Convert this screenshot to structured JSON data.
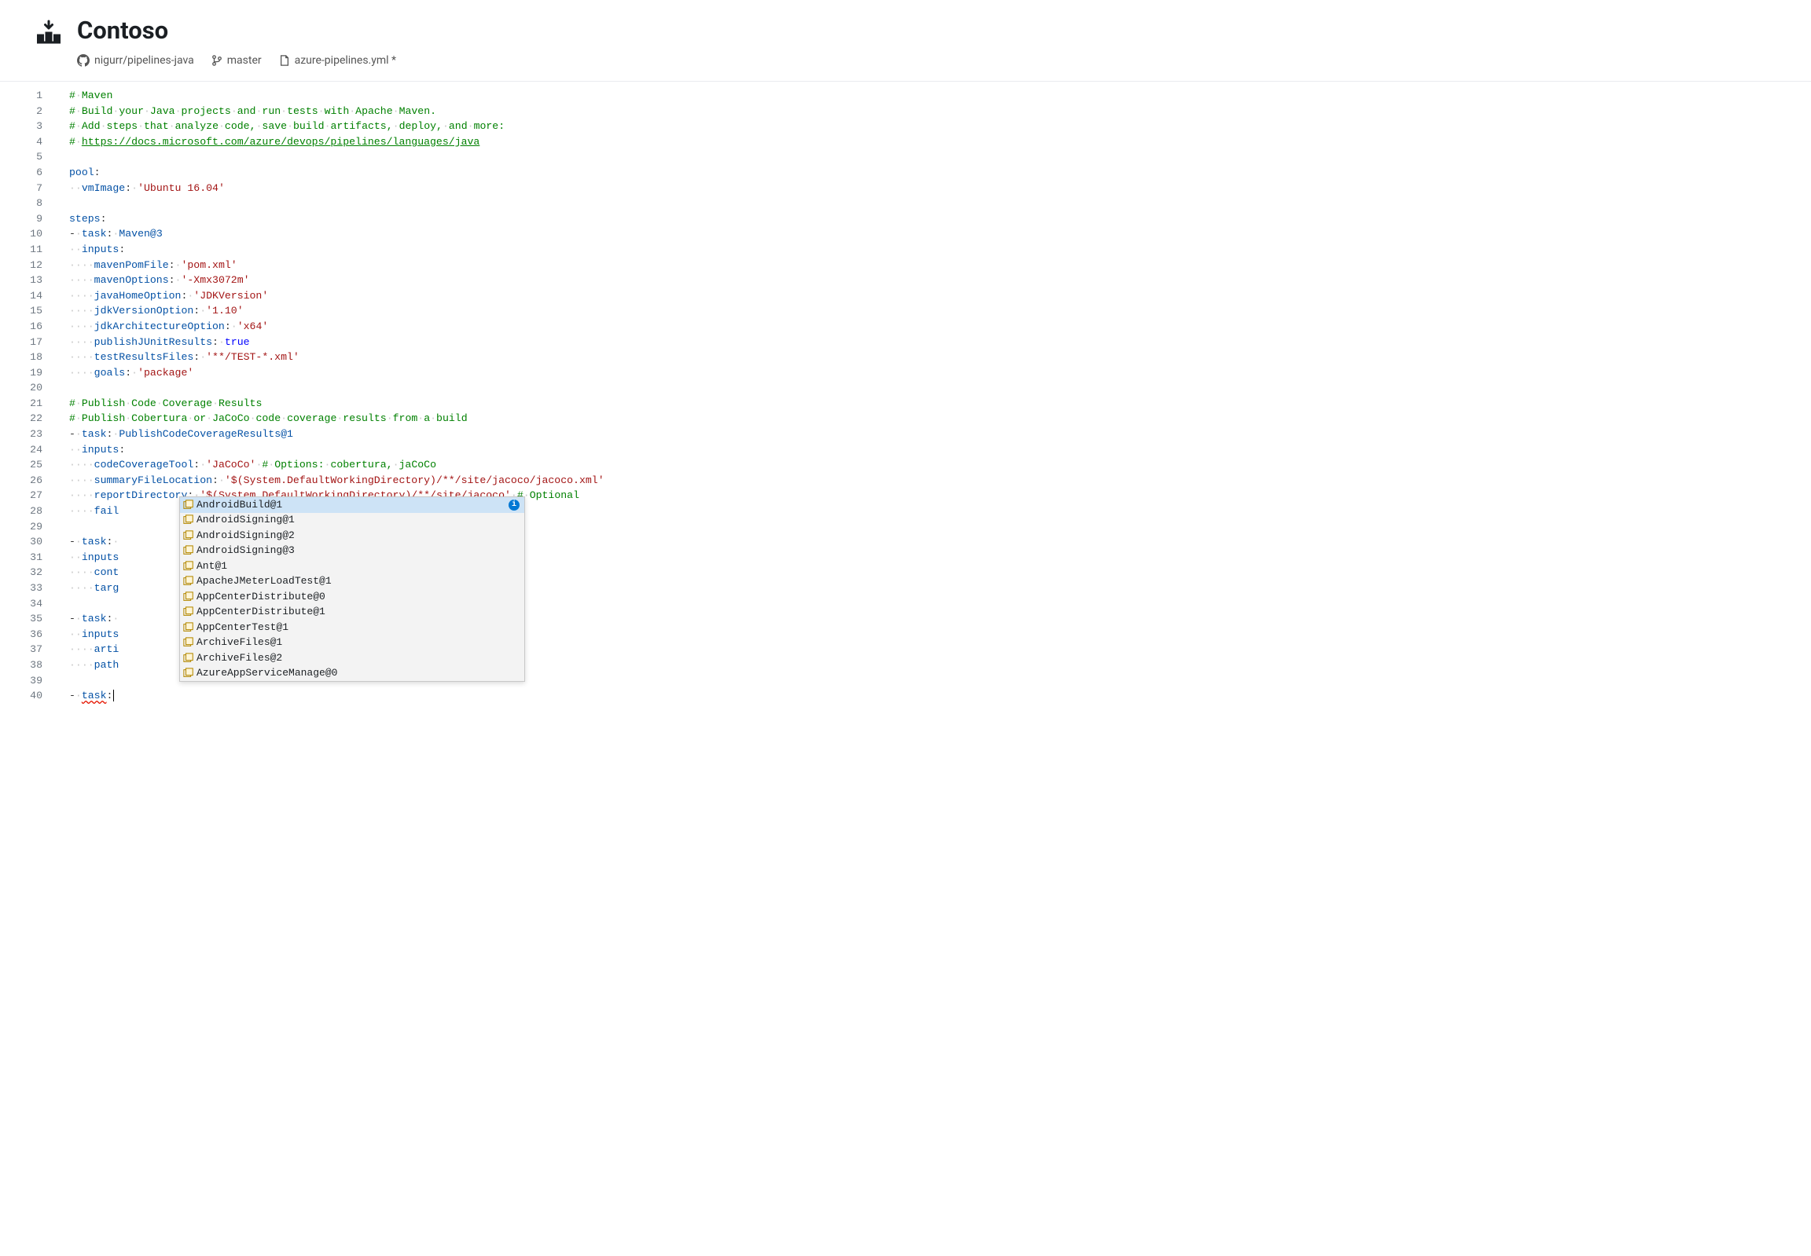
{
  "header": {
    "title": "Contoso",
    "repo_owner": "nigurr/pipelines-java",
    "branch": "master",
    "file": "azure-pipelines.yml *"
  },
  "code": {
    "lines": [
      {
        "n": 1,
        "segs": [
          {
            "c": "cm",
            "t": "#"
          },
          {
            "c": "dot",
            "t": "·"
          },
          {
            "c": "cm",
            "t": "Maven"
          }
        ]
      },
      {
        "n": 2,
        "segs": [
          {
            "c": "cm",
            "t": "#"
          },
          {
            "c": "dot",
            "t": "·"
          },
          {
            "c": "cm",
            "t": "Build"
          },
          {
            "c": "dot",
            "t": "·"
          },
          {
            "c": "cm",
            "t": "your"
          },
          {
            "c": "dot",
            "t": "·"
          },
          {
            "c": "cm",
            "t": "Java"
          },
          {
            "c": "dot",
            "t": "·"
          },
          {
            "c": "cm",
            "t": "projects"
          },
          {
            "c": "dot",
            "t": "·"
          },
          {
            "c": "cm",
            "t": "and"
          },
          {
            "c": "dot",
            "t": "·"
          },
          {
            "c": "cm",
            "t": "run"
          },
          {
            "c": "dot",
            "t": "·"
          },
          {
            "c": "cm",
            "t": "tests"
          },
          {
            "c": "dot",
            "t": "·"
          },
          {
            "c": "cm",
            "t": "with"
          },
          {
            "c": "dot",
            "t": "·"
          },
          {
            "c": "cm",
            "t": "Apache"
          },
          {
            "c": "dot",
            "t": "·"
          },
          {
            "c": "cm",
            "t": "Maven."
          }
        ]
      },
      {
        "n": 3,
        "segs": [
          {
            "c": "cm",
            "t": "#"
          },
          {
            "c": "dot",
            "t": "·"
          },
          {
            "c": "cm",
            "t": "Add"
          },
          {
            "c": "dot",
            "t": "·"
          },
          {
            "c": "cm",
            "t": "steps"
          },
          {
            "c": "dot",
            "t": "·"
          },
          {
            "c": "cm",
            "t": "that"
          },
          {
            "c": "dot",
            "t": "·"
          },
          {
            "c": "cm",
            "t": "analyze"
          },
          {
            "c": "dot",
            "t": "·"
          },
          {
            "c": "cm",
            "t": "code,"
          },
          {
            "c": "dot",
            "t": "·"
          },
          {
            "c": "cm",
            "t": "save"
          },
          {
            "c": "dot",
            "t": "·"
          },
          {
            "c": "cm",
            "t": "build"
          },
          {
            "c": "dot",
            "t": "·"
          },
          {
            "c": "cm",
            "t": "artifacts,"
          },
          {
            "c": "dot",
            "t": "·"
          },
          {
            "c": "cm",
            "t": "deploy,"
          },
          {
            "c": "dot",
            "t": "·"
          },
          {
            "c": "cm",
            "t": "and"
          },
          {
            "c": "dot",
            "t": "·"
          },
          {
            "c": "cm",
            "t": "more:"
          }
        ]
      },
      {
        "n": 4,
        "segs": [
          {
            "c": "cm",
            "t": "#"
          },
          {
            "c": "dot",
            "t": "·"
          },
          {
            "c": "cm-link",
            "t": "https://docs.microsoft.com/azure/devops/pipelines/languages/java"
          }
        ]
      },
      {
        "n": 5,
        "segs": []
      },
      {
        "n": 6,
        "segs": [
          {
            "c": "key",
            "t": "pool"
          },
          {
            "c": "punct",
            "t": ":"
          }
        ]
      },
      {
        "n": 7,
        "segs": [
          {
            "c": "dot",
            "t": "··"
          },
          {
            "c": "key",
            "t": "vmImage"
          },
          {
            "c": "punct",
            "t": ":"
          },
          {
            "c": "dot",
            "t": "·"
          },
          {
            "c": "str",
            "t": "'Ubuntu 16.04'"
          }
        ]
      },
      {
        "n": 8,
        "segs": []
      },
      {
        "n": 9,
        "segs": [
          {
            "c": "key",
            "t": "steps"
          },
          {
            "c": "punct",
            "t": ":"
          }
        ]
      },
      {
        "n": 10,
        "segs": [
          {
            "c": "punct",
            "t": "-"
          },
          {
            "c": "dot",
            "t": "·"
          },
          {
            "c": "key",
            "t": "task"
          },
          {
            "c": "punct",
            "t": ":"
          },
          {
            "c": "dot",
            "t": "·"
          },
          {
            "c": "val",
            "t": "Maven@3"
          }
        ]
      },
      {
        "n": 11,
        "segs": [
          {
            "c": "dot",
            "t": "··"
          },
          {
            "c": "key",
            "t": "inputs"
          },
          {
            "c": "punct",
            "t": ":"
          }
        ]
      },
      {
        "n": 12,
        "segs": [
          {
            "c": "dot",
            "t": "····"
          },
          {
            "c": "key",
            "t": "mavenPomFile"
          },
          {
            "c": "punct",
            "t": ":"
          },
          {
            "c": "dot",
            "t": "·"
          },
          {
            "c": "str",
            "t": "'pom.xml'"
          }
        ]
      },
      {
        "n": 13,
        "segs": [
          {
            "c": "dot",
            "t": "····"
          },
          {
            "c": "key",
            "t": "mavenOptions"
          },
          {
            "c": "punct",
            "t": ":"
          },
          {
            "c": "dot",
            "t": "·"
          },
          {
            "c": "str",
            "t": "'-Xmx3072m'"
          }
        ]
      },
      {
        "n": 14,
        "segs": [
          {
            "c": "dot",
            "t": "····"
          },
          {
            "c": "key",
            "t": "javaHomeOption"
          },
          {
            "c": "punct",
            "t": ":"
          },
          {
            "c": "dot",
            "t": "·"
          },
          {
            "c": "str",
            "t": "'JDKVersion'"
          }
        ]
      },
      {
        "n": 15,
        "segs": [
          {
            "c": "dot",
            "t": "····"
          },
          {
            "c": "key",
            "t": "jdkVersionOption"
          },
          {
            "c": "punct",
            "t": ":"
          },
          {
            "c": "dot",
            "t": "·"
          },
          {
            "c": "str",
            "t": "'1.10'"
          }
        ]
      },
      {
        "n": 16,
        "segs": [
          {
            "c": "dot",
            "t": "····"
          },
          {
            "c": "key",
            "t": "jdkArchitectureOption"
          },
          {
            "c": "punct",
            "t": ":"
          },
          {
            "c": "dot",
            "t": "·"
          },
          {
            "c": "str",
            "t": "'x64'"
          }
        ]
      },
      {
        "n": 17,
        "segs": [
          {
            "c": "dot",
            "t": "····"
          },
          {
            "c": "key",
            "t": "publishJUnitResults"
          },
          {
            "c": "punct",
            "t": ":"
          },
          {
            "c": "dot",
            "t": "·"
          },
          {
            "c": "bool",
            "t": "true"
          }
        ]
      },
      {
        "n": 18,
        "segs": [
          {
            "c": "dot",
            "t": "····"
          },
          {
            "c": "key",
            "t": "testResultsFiles"
          },
          {
            "c": "punct",
            "t": ":"
          },
          {
            "c": "dot",
            "t": "·"
          },
          {
            "c": "str",
            "t": "'**/TEST-*.xml'"
          }
        ]
      },
      {
        "n": 19,
        "segs": [
          {
            "c": "dot",
            "t": "····"
          },
          {
            "c": "key",
            "t": "goals"
          },
          {
            "c": "punct",
            "t": ":"
          },
          {
            "c": "dot",
            "t": "·"
          },
          {
            "c": "str",
            "t": "'package'"
          }
        ]
      },
      {
        "n": 20,
        "segs": []
      },
      {
        "n": 21,
        "segs": [
          {
            "c": "cm",
            "t": "#"
          },
          {
            "c": "dot",
            "t": "·"
          },
          {
            "c": "cm",
            "t": "Publish"
          },
          {
            "c": "dot",
            "t": "·"
          },
          {
            "c": "cm",
            "t": "Code"
          },
          {
            "c": "dot",
            "t": "·"
          },
          {
            "c": "cm",
            "t": "Coverage"
          },
          {
            "c": "dot",
            "t": "·"
          },
          {
            "c": "cm",
            "t": "Results"
          }
        ]
      },
      {
        "n": 22,
        "segs": [
          {
            "c": "cm",
            "t": "#"
          },
          {
            "c": "dot",
            "t": "·"
          },
          {
            "c": "cm",
            "t": "Publish"
          },
          {
            "c": "dot",
            "t": "·"
          },
          {
            "c": "cm",
            "t": "Cobertura"
          },
          {
            "c": "dot",
            "t": "·"
          },
          {
            "c": "cm",
            "t": "or"
          },
          {
            "c": "dot",
            "t": "·"
          },
          {
            "c": "cm",
            "t": "JaCoCo"
          },
          {
            "c": "dot",
            "t": "·"
          },
          {
            "c": "cm",
            "t": "code"
          },
          {
            "c": "dot",
            "t": "·"
          },
          {
            "c": "cm",
            "t": "coverage"
          },
          {
            "c": "dot",
            "t": "·"
          },
          {
            "c": "cm",
            "t": "results"
          },
          {
            "c": "dot",
            "t": "·"
          },
          {
            "c": "cm",
            "t": "from"
          },
          {
            "c": "dot",
            "t": "·"
          },
          {
            "c": "cm",
            "t": "a"
          },
          {
            "c": "dot",
            "t": "·"
          },
          {
            "c": "cm",
            "t": "build"
          }
        ]
      },
      {
        "n": 23,
        "segs": [
          {
            "c": "punct",
            "t": "-"
          },
          {
            "c": "dot",
            "t": "·"
          },
          {
            "c": "key",
            "t": "task"
          },
          {
            "c": "punct",
            "t": ":"
          },
          {
            "c": "dot",
            "t": "·"
          },
          {
            "c": "val",
            "t": "PublishCodeCoverageResults@1"
          }
        ]
      },
      {
        "n": 24,
        "segs": [
          {
            "c": "dot",
            "t": "··"
          },
          {
            "c": "key",
            "t": "inputs"
          },
          {
            "c": "punct",
            "t": ":"
          }
        ]
      },
      {
        "n": 25,
        "segs": [
          {
            "c": "dot",
            "t": "····"
          },
          {
            "c": "key",
            "t": "codeCoverageTool"
          },
          {
            "c": "punct",
            "t": ":"
          },
          {
            "c": "dot",
            "t": "·"
          },
          {
            "c": "str",
            "t": "'JaCoCo'"
          },
          {
            "c": "dot",
            "t": "·"
          },
          {
            "c": "cm",
            "t": "#"
          },
          {
            "c": "dot",
            "t": "·"
          },
          {
            "c": "cm",
            "t": "Options:"
          },
          {
            "c": "dot",
            "t": "·"
          },
          {
            "c": "cm",
            "t": "cobertura,"
          },
          {
            "c": "dot",
            "t": "·"
          },
          {
            "c": "cm",
            "t": "jaCoCo"
          }
        ]
      },
      {
        "n": 26,
        "segs": [
          {
            "c": "dot",
            "t": "····"
          },
          {
            "c": "key",
            "t": "summaryFileLocation"
          },
          {
            "c": "punct",
            "t": ":"
          },
          {
            "c": "dot",
            "t": "·"
          },
          {
            "c": "str",
            "t": "'$(System.DefaultWorkingDirectory)/**/site/jacoco/jacoco.xml'"
          }
        ]
      },
      {
        "n": 27,
        "segs": [
          {
            "c": "dot",
            "t": "····"
          },
          {
            "c": "key",
            "t": "reportDirectory"
          },
          {
            "c": "punct",
            "t": ":"
          },
          {
            "c": "dot",
            "t": "·"
          },
          {
            "c": "str",
            "t": "'$(System.DefaultWorkingDirectory)/**/site/jacoco'"
          },
          {
            "c": "dot",
            "t": "·"
          },
          {
            "c": "cm",
            "t": "#"
          },
          {
            "c": "dot",
            "t": "·"
          },
          {
            "c": "cm",
            "t": "Optional"
          }
        ]
      },
      {
        "n": 28,
        "segs": [
          {
            "c": "dot",
            "t": "····"
          },
          {
            "c": "key",
            "t": "fail"
          }
        ]
      },
      {
        "n": 29,
        "segs": []
      },
      {
        "n": 30,
        "segs": [
          {
            "c": "punct",
            "t": "-"
          },
          {
            "c": "dot",
            "t": "·"
          },
          {
            "c": "key",
            "t": "task"
          },
          {
            "c": "punct",
            "t": ":"
          },
          {
            "c": "dot",
            "t": "·"
          }
        ]
      },
      {
        "n": 31,
        "segs": [
          {
            "c": "dot",
            "t": "··"
          },
          {
            "c": "key",
            "t": "inputs"
          }
        ]
      },
      {
        "n": 32,
        "segs": [
          {
            "c": "dot",
            "t": "····"
          },
          {
            "c": "key",
            "t": "cont"
          }
        ]
      },
      {
        "n": 33,
        "segs": [
          {
            "c": "dot",
            "t": "····"
          },
          {
            "c": "key",
            "t": "targ"
          }
        ]
      },
      {
        "n": 34,
        "segs": []
      },
      {
        "n": 35,
        "segs": [
          {
            "c": "punct",
            "t": "-"
          },
          {
            "c": "dot",
            "t": "·"
          },
          {
            "c": "key",
            "t": "task"
          },
          {
            "c": "punct",
            "t": ":"
          },
          {
            "c": "dot",
            "t": "·"
          }
        ]
      },
      {
        "n": 36,
        "segs": [
          {
            "c": "dot",
            "t": "··"
          },
          {
            "c": "key",
            "t": "inputs"
          }
        ]
      },
      {
        "n": 37,
        "segs": [
          {
            "c": "dot",
            "t": "····"
          },
          {
            "c": "key",
            "t": "arti"
          }
        ]
      },
      {
        "n": 38,
        "segs": [
          {
            "c": "dot",
            "t": "····"
          },
          {
            "c": "key",
            "t": "path"
          }
        ]
      },
      {
        "n": 39,
        "segs": []
      },
      {
        "n": 40,
        "segs": [
          {
            "c": "punct",
            "t": "-"
          },
          {
            "c": "dot",
            "t": "·"
          },
          {
            "c": "key squiggle",
            "t": "task"
          },
          {
            "c": "punct",
            "t": ":"
          }
        ],
        "cursor": true
      }
    ]
  },
  "popup": {
    "items": [
      {
        "label": "AndroidBuild@1",
        "selected": true,
        "expandable": true
      },
      {
        "label": "AndroidSigning@1"
      },
      {
        "label": "AndroidSigning@2"
      },
      {
        "label": "AndroidSigning@3"
      },
      {
        "label": "Ant@1"
      },
      {
        "label": "ApacheJMeterLoadTest@1"
      },
      {
        "label": "AppCenterDistribute@0"
      },
      {
        "label": "AppCenterDistribute@1"
      },
      {
        "label": "AppCenterTest@1"
      },
      {
        "label": "ArchiveFiles@1"
      },
      {
        "label": "ArchiveFiles@2"
      },
      {
        "label": "AzureAppServiceManage@0"
      }
    ]
  }
}
